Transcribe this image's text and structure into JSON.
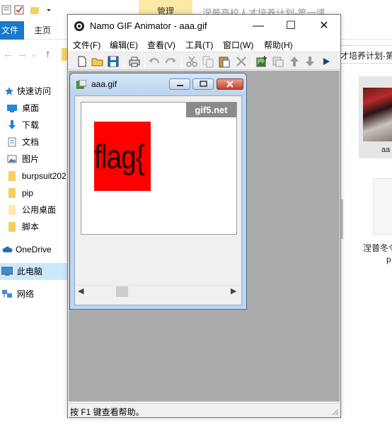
{
  "explorer": {
    "context_tab": "管理",
    "window_title": "涅普高校人才培养计划-第一课",
    "tabs": {
      "file": "文件",
      "home": "主页"
    },
    "address_tail": "才培养计划-第",
    "nav_items": [
      {
        "label": "快速访问",
        "icon": "star-icon"
      },
      {
        "label": "桌面",
        "icon": "desktop-icon"
      },
      {
        "label": "下载",
        "icon": "download-icon"
      },
      {
        "label": "文档",
        "icon": "document-icon"
      },
      {
        "label": "图片",
        "icon": "picture-icon"
      },
      {
        "label": "burpsuit202",
        "icon": "folder-icon"
      },
      {
        "label": "pip",
        "icon": "folder-icon"
      },
      {
        "label": "公用桌面",
        "icon": "folder-icon"
      },
      {
        "label": "脚本",
        "icon": "folder-icon"
      },
      {
        "label": "OneDrive",
        "icon": "cloud-icon"
      },
      {
        "label": "此电脑",
        "icon": "computer-icon",
        "selected": true
      },
      {
        "label": "网络",
        "icon": "network-icon"
      }
    ],
    "thumb_label": "aa",
    "file_caption_1": "涅普冬令",
    "file_caption_2": "p"
  },
  "namo": {
    "title": "Namo GIF Animator - aaa.gif",
    "menu": [
      "文件(F)",
      "编辑(E)",
      "查看(V)",
      "工具(T)",
      "窗口(W)",
      "帮助(H)"
    ],
    "status": "按 F1 键查看帮助。",
    "child": {
      "title": "aaa.gif",
      "watermark": "gif5.net",
      "frame_text": "flag{",
      "frame_color": "#ff0000"
    }
  },
  "colors": {
    "accent": "#1979ca",
    "context_tab_bg": "#fce9a5",
    "mdi_bg": "#ababab"
  }
}
